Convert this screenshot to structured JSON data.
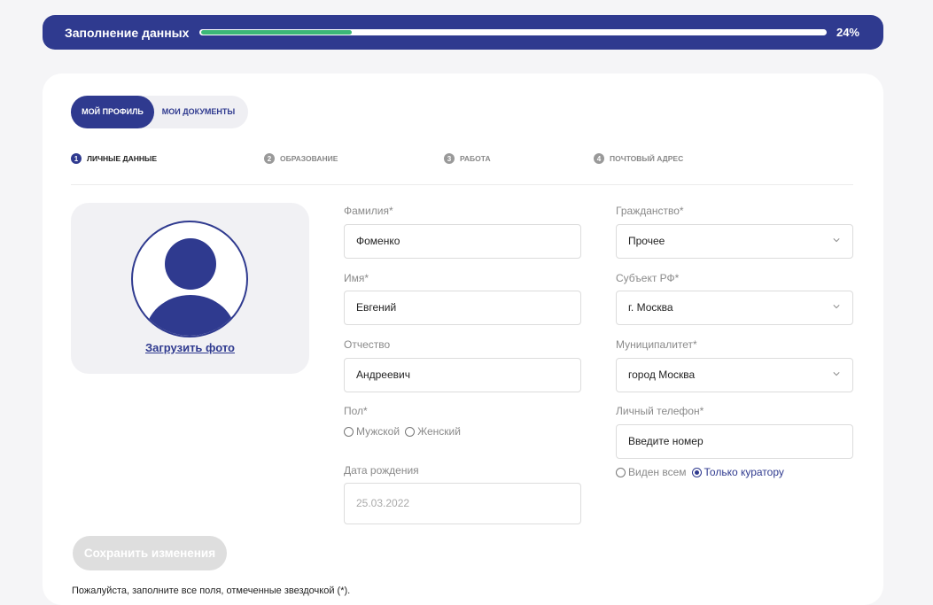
{
  "progress": {
    "title": "Заполнение данных",
    "percent_label": "24%",
    "percent_value": 0.24,
    "accent_color": "#2f3a8f",
    "fill_color": "#3cb878"
  },
  "tabs": [
    {
      "label": "Мой профиль",
      "active": true
    },
    {
      "label": "Мои документы",
      "active": false
    }
  ],
  "steps": [
    {
      "number": "1",
      "label": "Личные данные",
      "active": true
    },
    {
      "number": "2",
      "label": "Образование",
      "active": false
    },
    {
      "number": "3",
      "label": "Работа",
      "active": false
    },
    {
      "number": "4",
      "label": "Почтовый адрес",
      "active": false
    }
  ],
  "photo": {
    "upload_label": "Загрузить фото",
    "icon": "user-avatar-icon"
  },
  "form": {
    "lastname": {
      "label": "Фамилия*",
      "value": "Фоменко"
    },
    "firstname": {
      "label": "Имя*",
      "value": "Евгений"
    },
    "patronymic": {
      "label": "Отчество",
      "value": "Андреевич"
    },
    "gender": {
      "label": "Пол*",
      "options": [
        "Мужской",
        "Женский"
      ],
      "selected": null
    },
    "birthdate": {
      "label": "Дата рождения",
      "value": "25.03.2022"
    },
    "citizenship": {
      "label": "Гражданство*",
      "value": "Прочее"
    },
    "region": {
      "label": "Субъект РФ*",
      "value": "г. Москва"
    },
    "municipality": {
      "label": "Муниципалитет*",
      "value": "город Москва"
    },
    "phone": {
      "label": "Личный телефон*",
      "placeholder": "Введите номер",
      "visibility_options": [
        "Виден всем",
        "Только куратору"
      ],
      "visibility_selected": "Только куратору"
    }
  },
  "save_button": "Сохранить изменения",
  "note": "Пожалуйста, заполните все поля, отмеченные звездочкой (*)."
}
